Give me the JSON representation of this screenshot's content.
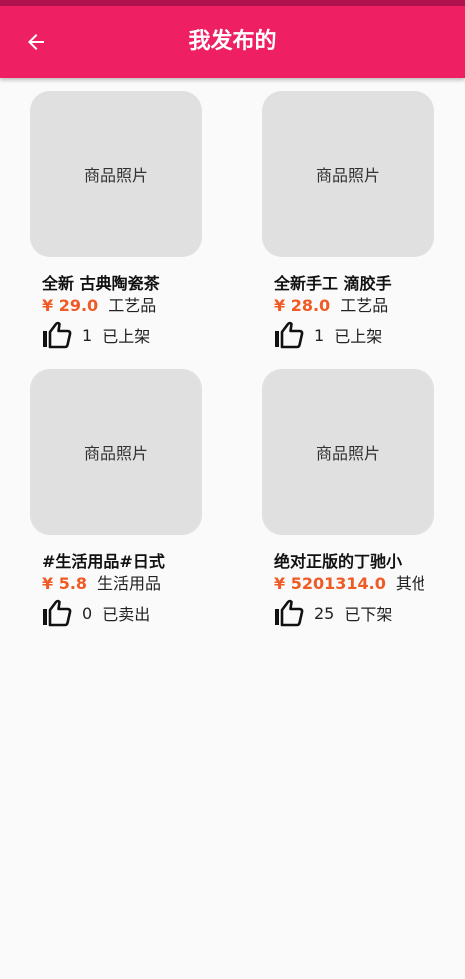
{
  "appbar": {
    "title": "我发布的",
    "back_icon": "arrow-left-icon"
  },
  "products": [
    {
      "photo_label": "商品照片",
      "title": "全新 古典陶瓷茶",
      "price": "¥ 29.0",
      "category": "工艺品",
      "likes": "1",
      "status": "已上架"
    },
    {
      "photo_label": "商品照片",
      "title": "全新手工 滴胶手",
      "price": "¥ 28.0",
      "category": "工艺品",
      "likes": "1",
      "status": "已上架"
    },
    {
      "photo_label": "商品照片",
      "title": "#生活用品#日式",
      "price": "¥ 5.8",
      "category": "生活用品",
      "likes": "0",
      "status": "已卖出"
    },
    {
      "photo_label": "商品照片",
      "title": "绝对正版的丁驰小",
      "price": "¥ 5201314.0",
      "category": "其他",
      "likes": "25",
      "status": "已下架"
    }
  ],
  "colors": {
    "appbar": "#ee1f63",
    "price": "#f05a24",
    "photo_placeholder": "#e0e0e0"
  }
}
